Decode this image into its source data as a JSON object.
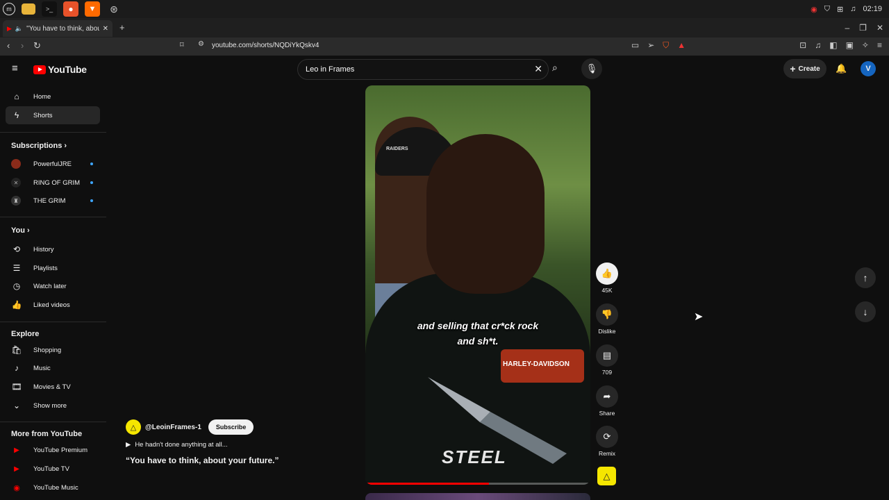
{
  "taskbar": {
    "clock": "02:19",
    "apps": [
      "mint-menu-icon",
      "files-icon",
      "terminal-icon",
      "firefox-icon",
      "brave-icon",
      "settings-icon"
    ]
  },
  "browser": {
    "tab_title": "\"You have to think, about y",
    "url": "youtube.com/shorts/NQDiYkQskv4"
  },
  "header": {
    "logo_text": "YouTube",
    "search_value": "Leo in Frames",
    "create_label": "Create",
    "avatar_letter": "V"
  },
  "sidebar": {
    "primary": [
      {
        "label": "Home",
        "icon": "home-icon"
      },
      {
        "label": "Shorts",
        "icon": "shorts-icon",
        "active": true
      }
    ],
    "subscriptions_heading": "Subscriptions",
    "subscriptions": [
      {
        "label": "PowerfulJRE"
      },
      {
        "label": "RING OF GRIM"
      },
      {
        "label": "THE GRIM"
      }
    ],
    "you_heading": "You",
    "you": [
      {
        "label": "History",
        "icon": "history-icon"
      },
      {
        "label": "Playlists",
        "icon": "playlists-icon"
      },
      {
        "label": "Watch later",
        "icon": "watch-later-icon"
      },
      {
        "label": "Liked videos",
        "icon": "liked-icon"
      }
    ],
    "explore_heading": "Explore",
    "explore": [
      {
        "label": "Shopping",
        "icon": "shopping-icon"
      },
      {
        "label": "Music",
        "icon": "music-icon"
      },
      {
        "label": "Movies & TV",
        "icon": "movies-icon"
      },
      {
        "label": "Show more",
        "icon": "chevron-down-icon"
      }
    ],
    "more_heading": "More from YouTube",
    "more": [
      {
        "label": "YouTube Premium"
      },
      {
        "label": "YouTube TV"
      },
      {
        "label": "YouTube Music"
      }
    ]
  },
  "short": {
    "caption_line1": "and selling that cr*ck rock",
    "caption_line2": "and sh*t.",
    "shirt_text_1": "HARLEY-DAVIDSON",
    "shirt_text_2": "STEEL",
    "cap_text": "RAIDERS",
    "progress": 0.55,
    "channel": "@LeoinFrames-1",
    "subscribe_label": "Subscribe",
    "music_text": "He hadn't done anything at all...",
    "title": "“You have to think, about your future.”",
    "actions": {
      "likes": "45K",
      "dislike": "Dislike",
      "comments": "709",
      "share": "Share",
      "remix": "Remix"
    }
  },
  "colors": {
    "background": "#0f0f0f",
    "accent_red": "#ff0000",
    "subscription_dot": "#3ea6ff",
    "channel_avatar": "#f5e600"
  }
}
